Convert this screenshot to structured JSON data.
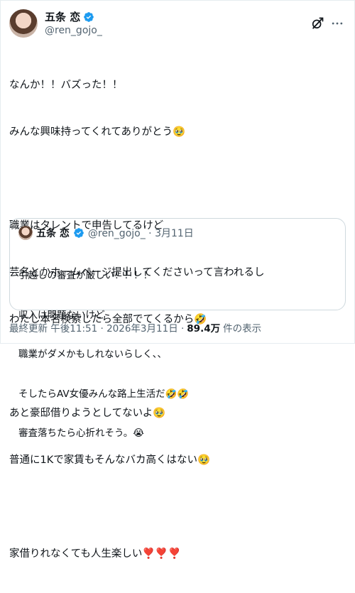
{
  "post": {
    "author": {
      "display_name": "五条 恋",
      "handle": "@ren_gojo_"
    },
    "lines": [
      "なんか！！バズった！！",
      "みんな興味持ってくれてありがとう🥹",
      "",
      "職業はタレントで申告してるけど",
      "芸名とかホームページ提出してくださいって言われるし",
      "わたし本名検索したら全部でてくるから🤣",
      "",
      "あと豪邸借りようとしてないよ🥹",
      "普通に1Kで家賃もそんなバカ高くはない🥹",
      "",
      "家借りれなくても人生楽しい❣️❣️❣️"
    ],
    "quote": {
      "display_name": "五条 恋",
      "meta": "@ren_gojo_ · 3月11日",
      "lines": [
        "引越しの審査が厳しい！！！！",
        "収入は問題ないけど",
        "職業がダメかもしれないらしく、、",
        "そしたらAV女優みんな路上生活だ🤣🤣",
        "審査落ちたら心折れそう。😭"
      ]
    },
    "footer": {
      "prefix": "最終更新 午後11:51 · 2026年3月11日 ·",
      "views_count": "89.4万",
      "views_suffix": "件の表示"
    }
  },
  "icons": {
    "badge": "verified-badge-icon",
    "grok": "grok-icon",
    "more": "more-dots-icon"
  },
  "colors": {
    "badge_blue": "#1d9bf0",
    "secondary_text": "#536471",
    "border": "#cfd9de"
  }
}
